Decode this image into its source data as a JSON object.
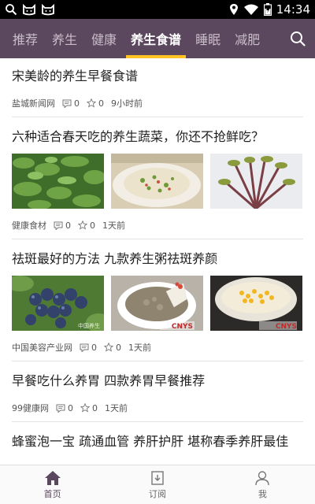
{
  "status_bar": {
    "time": "14:34",
    "left_icons": [
      "search-icon",
      "cat-face-icon",
      "cat-face-icon"
    ],
    "right_icons": [
      "location-icon",
      "wifi-icon",
      "battery-icon"
    ]
  },
  "category_tabs": [
    {
      "label": "推荐",
      "active": false
    },
    {
      "label": "养生",
      "active": false
    },
    {
      "label": "健康",
      "active": false
    },
    {
      "label": "养生食谱",
      "active": true
    },
    {
      "label": "睡眠",
      "active": false
    },
    {
      "label": "减肥",
      "active": false
    }
  ],
  "colors": {
    "nav_bg": "#5b475e",
    "tab_indicator": "#ffc421",
    "active_bottom_tab": "#5b475e"
  },
  "articles": [
    {
      "title": "宋美龄的养生早餐食谱",
      "source": "盐城新闻网",
      "comments": "0",
      "likes": "0",
      "time": "9小时前",
      "images": []
    },
    {
      "title": "六种适合春天吃的养生蔬菜，你还不抢鲜吃？",
      "source": "健康食材",
      "comments": "0",
      "likes": "0",
      "time": "1天前",
      "images": [
        "green-leafy-vegetables",
        "rice-with-vegetables-plate",
        "toon-sprouts"
      ]
    },
    {
      "title": "祛斑最好的方法 九款养生粥祛斑养颜",
      "source": "中国美容产业网",
      "comments": "0",
      "likes": "0",
      "time": "1天前",
      "images": [
        "blueberries",
        "porridge-bowl",
        "corn-soup-bowl"
      ]
    },
    {
      "title": "早餐吃什么养胃 四款养胃早餐推荐",
      "source": "99健康网",
      "comments": "0",
      "likes": "0",
      "time": "1天前",
      "images": []
    },
    {
      "title": "蜂蜜泡一宝 疏通血管 养肝护肝 堪称春季养肝最佳",
      "source": "",
      "comments": "",
      "likes": "",
      "time": "",
      "images": []
    }
  ],
  "watermarks": [
    "CNYS",
    "CNYS",
    "中国养生"
  ],
  "bottom_nav": [
    {
      "label": "首页",
      "icon": "home-icon",
      "active": true
    },
    {
      "label": "订阅",
      "icon": "subscribe-icon",
      "active": false
    },
    {
      "label": "我",
      "icon": "user-icon",
      "active": false
    }
  ]
}
